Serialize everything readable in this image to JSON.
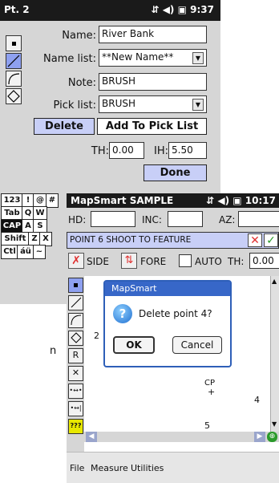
{
  "back": {
    "title": "Pt. 2",
    "time": "9:37",
    "name_label": "Name:",
    "name_value": "River Bank",
    "namelist_label": "Name list:",
    "namelist_value": "**New Name**",
    "note_label": "Note:",
    "note_value": "BRUSH",
    "picklist_label": "Pick list:",
    "picklist_value": "BRUSH",
    "delete_label": "Delete",
    "add_label": "Add To Pick List",
    "th_label": "TH:",
    "th_value": "0.00",
    "ih_label": "IH:",
    "ih_value": "5.50",
    "done_label": "Done"
  },
  "keyboard": {
    "rows": [
      [
        "123",
        "!",
        "@",
        "#"
      ],
      [
        "Tab",
        "Q",
        "W"
      ],
      [
        "CAP",
        "A",
        "S"
      ],
      [
        "Shift",
        "Z",
        "X"
      ],
      [
        "Ctl",
        "áü",
        "~"
      ]
    ]
  },
  "front": {
    "title": "MapSmart SAMPLE",
    "time": "10:17",
    "hd_label": "HD:",
    "inc_label": "INC:",
    "az_label": "AZ:",
    "point_text": "POINT 6 SHOOT TO FEATURE",
    "side_label": "SIDE",
    "fore_label": "FORE",
    "auto_label": "AUTO",
    "th_label": "TH:",
    "th_value": "0.00",
    "map_labels": {
      "p2": "2",
      "cp": "CP",
      "p4": "4",
      "p5": "5"
    },
    "left_tools": [
      "R",
      "✕",
      "•↔•",
      "•↔|",
      "???"
    ],
    "menu": [
      "File",
      "Measure",
      "Utilities"
    ]
  },
  "dialog": {
    "title": "MapSmart",
    "message": "Delete point 4?",
    "ok_label": "OK",
    "cancel_label": "Cancel"
  },
  "side_text": "n",
  "colors": {
    "title_bar": "#1a1a1a",
    "panel": "#d6d6d6",
    "button_blue": "#c8cff7",
    "dialog_blue": "#3767c8",
    "cancel_red": "#e03030",
    "confirm_green": "#2a9a2a"
  }
}
